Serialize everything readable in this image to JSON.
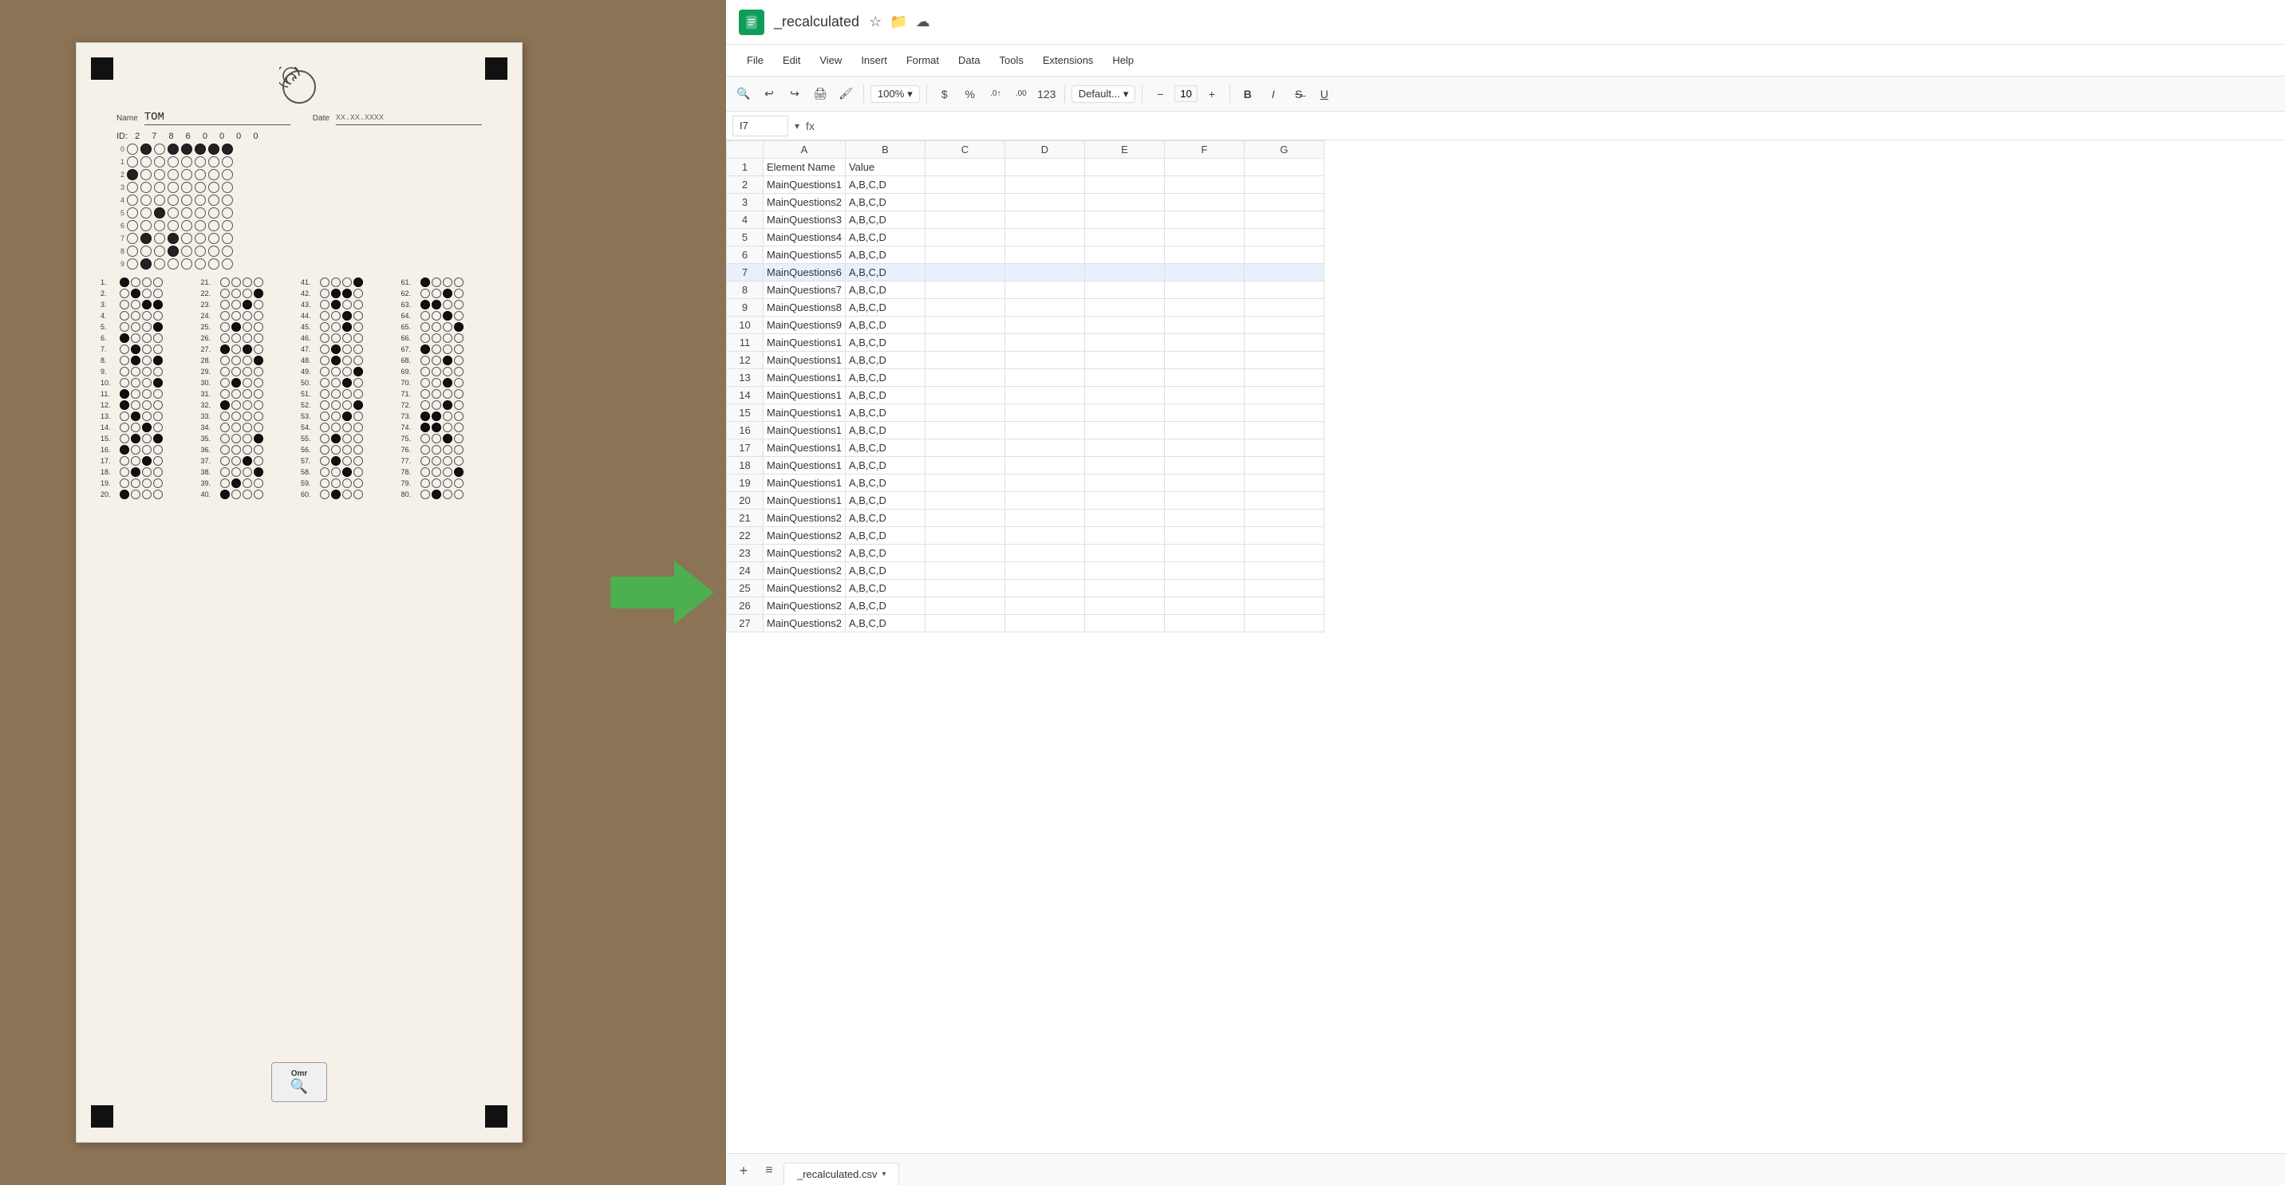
{
  "app": {
    "title": "_recalculated",
    "icon": "☰"
  },
  "menu": {
    "items": [
      "File",
      "Edit",
      "View",
      "Insert",
      "Format",
      "Data",
      "Tools",
      "Extensions",
      "Help"
    ]
  },
  "toolbar": {
    "zoom": "100%",
    "currency": "$",
    "percent": "%",
    "decimal_more": ".0↑",
    "decimal_less": ".00",
    "format_num": "123",
    "font_name": "Default...",
    "font_size": "10",
    "bold": "B",
    "italic": "I",
    "strikethrough": "S̶",
    "underline": "U"
  },
  "formula_bar": {
    "cell_ref": "I7",
    "formula": "fx"
  },
  "columns": {
    "headers": [
      "",
      "A",
      "B",
      "C",
      "D",
      "E",
      "F",
      "G"
    ]
  },
  "rows": [
    {
      "num": 1,
      "A": "Element Name",
      "B": "Value",
      "C": "",
      "D": "",
      "E": "",
      "F": "",
      "G": ""
    },
    {
      "num": 2,
      "A": "MainQuestions1",
      "B": "A,B,C,D",
      "C": "",
      "D": "",
      "E": "",
      "F": "",
      "G": ""
    },
    {
      "num": 3,
      "A": "MainQuestions2",
      "B": "A,B,C,D",
      "C": "",
      "D": "",
      "E": "",
      "F": "",
      "G": ""
    },
    {
      "num": 4,
      "A": "MainQuestions3",
      "B": "A,B,C,D",
      "C": "",
      "D": "",
      "E": "",
      "F": "",
      "G": ""
    },
    {
      "num": 5,
      "A": "MainQuestions4",
      "B": "A,B,C,D",
      "C": "",
      "D": "",
      "E": "",
      "F": "",
      "G": ""
    },
    {
      "num": 6,
      "A": "MainQuestions5",
      "B": "A,B,C,D",
      "C": "",
      "D": "",
      "E": "",
      "F": "",
      "G": ""
    },
    {
      "num": 7,
      "A": "MainQuestions6",
      "B": "A,B,C,D",
      "C": "",
      "D": "",
      "E": "",
      "F": "",
      "G": "",
      "selected": true
    },
    {
      "num": 8,
      "A": "MainQuestions7",
      "B": "A,B,C,D",
      "C": "",
      "D": "",
      "E": "",
      "F": "",
      "G": ""
    },
    {
      "num": 9,
      "A": "MainQuestions8",
      "B": "A,B,C,D",
      "C": "",
      "D": "",
      "E": "",
      "F": "",
      "G": ""
    },
    {
      "num": 10,
      "A": "MainQuestions9",
      "B": "A,B,C,D",
      "C": "",
      "D": "",
      "E": "",
      "F": "",
      "G": ""
    },
    {
      "num": 11,
      "A": "MainQuestions1",
      "B": "A,B,C,D",
      "C": "",
      "D": "",
      "E": "",
      "F": "",
      "G": ""
    },
    {
      "num": 12,
      "A": "MainQuestions1",
      "B": "A,B,C,D",
      "C": "",
      "D": "",
      "E": "",
      "F": "",
      "G": ""
    },
    {
      "num": 13,
      "A": "MainQuestions1",
      "B": "A,B,C,D",
      "C": "",
      "D": "",
      "E": "",
      "F": "",
      "G": ""
    },
    {
      "num": 14,
      "A": "MainQuestions1",
      "B": "A,B,C,D",
      "C": "",
      "D": "",
      "E": "",
      "F": "",
      "G": ""
    },
    {
      "num": 15,
      "A": "MainQuestions1",
      "B": "A,B,C,D",
      "C": "",
      "D": "",
      "E": "",
      "F": "",
      "G": ""
    },
    {
      "num": 16,
      "A": "MainQuestions1",
      "B": "A,B,C,D",
      "C": "",
      "D": "",
      "E": "",
      "F": "",
      "G": ""
    },
    {
      "num": 17,
      "A": "MainQuestions1",
      "B": "A,B,C,D",
      "C": "",
      "D": "",
      "E": "",
      "F": "",
      "G": ""
    },
    {
      "num": 18,
      "A": "MainQuestions1",
      "B": "A,B,C,D",
      "C": "",
      "D": "",
      "E": "",
      "F": "",
      "G": ""
    },
    {
      "num": 19,
      "A": "MainQuestions1",
      "B": "A,B,C,D",
      "C": "",
      "D": "",
      "E": "",
      "F": "",
      "G": ""
    },
    {
      "num": 20,
      "A": "MainQuestions1",
      "B": "A,B,C,D",
      "C": "",
      "D": "",
      "E": "",
      "F": "",
      "G": ""
    },
    {
      "num": 21,
      "A": "MainQuestions2",
      "B": "A,B,C,D",
      "C": "",
      "D": "",
      "E": "",
      "F": "",
      "G": ""
    },
    {
      "num": 22,
      "A": "MainQuestions2",
      "B": "A,B,C,D",
      "C": "",
      "D": "",
      "E": "",
      "F": "",
      "G": ""
    },
    {
      "num": 23,
      "A": "MainQuestions2",
      "B": "A,B,C,D",
      "C": "",
      "D": "",
      "E": "",
      "F": "",
      "G": ""
    },
    {
      "num": 24,
      "A": "MainQuestions2",
      "B": "A,B,C,D",
      "C": "",
      "D": "",
      "E": "",
      "F": "",
      "G": ""
    },
    {
      "num": 25,
      "A": "MainQuestions2",
      "B": "A,B,C,D",
      "C": "",
      "D": "",
      "E": "",
      "F": "",
      "G": ""
    },
    {
      "num": 26,
      "A": "MainQuestions2",
      "B": "A,B,C,D",
      "C": "",
      "D": "",
      "E": "",
      "F": "",
      "G": ""
    },
    {
      "num": 27,
      "A": "MainQuestions2",
      "B": "A,B,C,D",
      "C": "",
      "D": "",
      "E": "",
      "F": "",
      "G": ""
    }
  ],
  "tab": {
    "label": "_recalculated.csv",
    "add_icon": "+",
    "menu_icon": "≡"
  },
  "omr": {
    "name_label": "Name",
    "name_value": "TOM",
    "date_label": "Date",
    "date_value": "XX.XX.XXXX",
    "id_label": "ID:",
    "id_value": "2 7 8 6 0 0 0 0",
    "icon_label": "Omr"
  },
  "colors": {
    "sheets_green": "#0f9d58",
    "selected_blue": "#1a73e8",
    "selected_row_bg": "#e8f0fe",
    "arrow_green": "#4CAF50",
    "wood_bg": "#8B7355",
    "sheet_bg": "#f5f0e8"
  }
}
